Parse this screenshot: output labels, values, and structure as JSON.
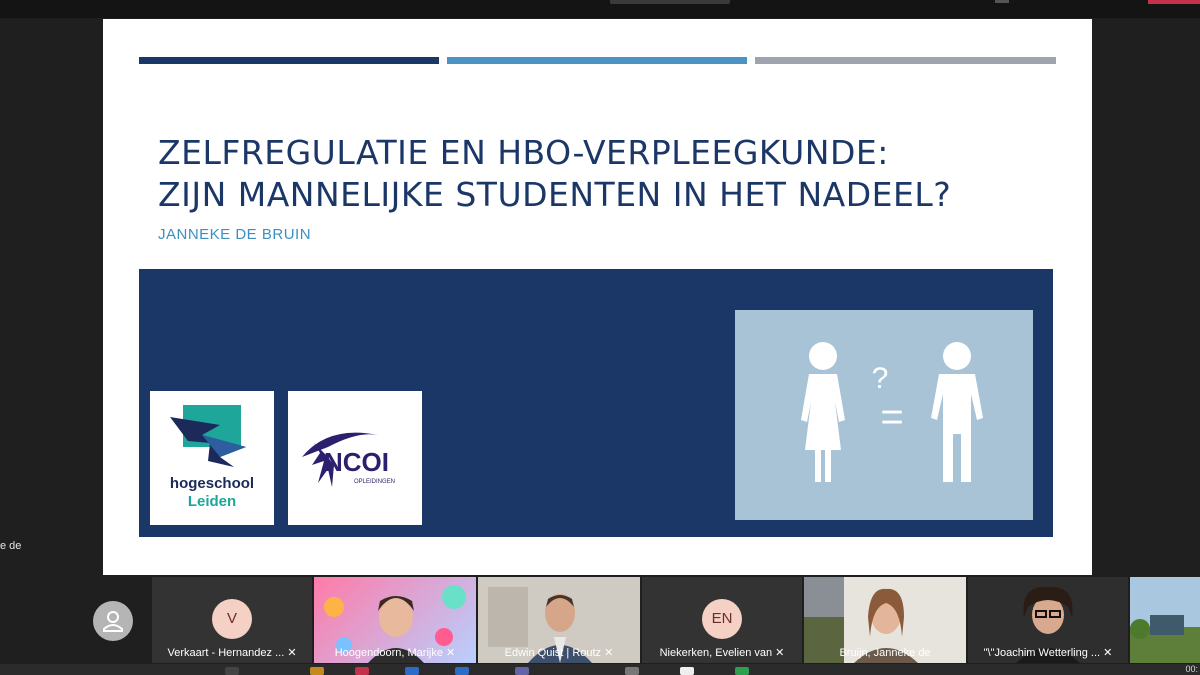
{
  "slide": {
    "title_line1": "ZELFREGULATIE EN HBO-VERPLEEGKUNDE:",
    "title_line2": "ZIJN MANNELIJKE STUDENTEN IN HET NADEEL?",
    "author": "JANNEKE DE BRUIN",
    "logos": [
      {
        "name": "hogeschool Leiden",
        "line1": "hogeschool",
        "line2": "Leiden"
      },
      {
        "name": "NCOI",
        "text": "NCOI",
        "sub": "OPLEIDINGEN"
      }
    ],
    "illustration": {
      "question_mark": "?",
      "equals": "="
    },
    "colors": {
      "navy": "#1b3768",
      "blue": "#4a93c2",
      "gray": "#9ea4ad",
      "panel": "#a9c3d6"
    }
  },
  "side_label": "e de",
  "participants": [
    {
      "name": "Verkaart - Hernandez ...",
      "initials": "V",
      "muted": true
    },
    {
      "name": "Hoogendoorn, Marijke",
      "muted": true
    },
    {
      "name": "Edwin Quist | Routz",
      "muted": true
    },
    {
      "name": "Niekerken, Evelien van",
      "initials": "EN",
      "muted": true
    },
    {
      "name": "Bruijn, Janneke de",
      "muted": false
    },
    {
      "name": "\"\\\"Joachim Wetterling ...",
      "muted": true
    }
  ],
  "taskbar": {
    "clock": "00:"
  }
}
